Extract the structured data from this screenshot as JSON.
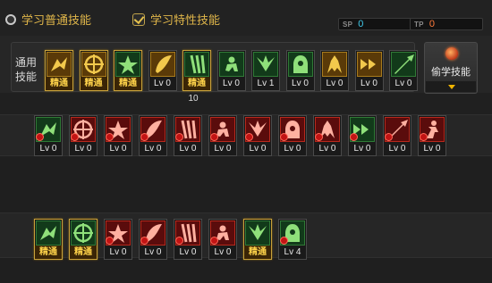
{
  "tabs": {
    "normal": {
      "label": "学习普通技能",
      "selected": false
    },
    "special": {
      "label": "学习特性技能",
      "selected": true
    }
  },
  "counters": [
    {
      "tag": "SP",
      "value": "0",
      "color": "#40c8e8"
    },
    {
      "tag": "TP",
      "value": "0",
      "color": "#ff7a3a"
    }
  ],
  "general": {
    "label": "通用技能",
    "cost_value": "10",
    "skills": [
      {
        "icon": "seated-figure-icon",
        "status": "精通",
        "mastered": true,
        "hue": "gold"
      },
      {
        "icon": "leaping-figure-icon",
        "status": "精通",
        "mastered": true,
        "hue": "gold"
      },
      {
        "icon": "runner-icon",
        "status": "精通",
        "mastered": true,
        "hue": "green"
      },
      {
        "icon": "wings-icon",
        "status": "Lv 0",
        "mastered": false,
        "hue": "gold"
      },
      {
        "icon": "crosshair-icon",
        "status": "精通",
        "mastered": true,
        "hue": "green"
      },
      {
        "icon": "gear-arrows-icon",
        "status": "Lv 0",
        "mastered": false,
        "hue": "green"
      },
      {
        "icon": "hooded-figure-icon",
        "status": "Lv 1",
        "mastered": false,
        "hue": "green"
      },
      {
        "icon": "figure-burst-icon",
        "status": "Lv 0",
        "mastered": false,
        "hue": "green"
      },
      {
        "icon": "coin-icon",
        "status": "Lv 0",
        "mastered": false,
        "hue": "gold"
      },
      {
        "icon": "golden-figure-icon",
        "status": "Lv 0",
        "mastered": false,
        "hue": "gold"
      },
      {
        "icon": "leaf-figure-icon",
        "status": "Lv 0",
        "mastered": false,
        "hue": "green"
      }
    ]
  },
  "steal": {
    "label": "偷学技能"
  },
  "class_row_1": [
    {
      "icon": "runner-green-icon",
      "status": "Lv 0",
      "mastered": false
    },
    {
      "icon": "slash-arc-icon",
      "status": "Lv 0",
      "mastered": false
    },
    {
      "icon": "slash-arc-icon",
      "status": "Lv 0",
      "mastered": false
    },
    {
      "icon": "double-chevron-icon",
      "status": "Lv 0",
      "mastered": false
    },
    {
      "icon": "claw-marks-icon",
      "status": "Lv 0",
      "mastered": false
    },
    {
      "icon": "shield-cross-icon",
      "status": "Lv 0",
      "mastered": false
    },
    {
      "icon": "spear-thrust-icon",
      "status": "Lv 0",
      "mastered": false
    },
    {
      "icon": "crescent-slash-icon",
      "status": "Lv 0",
      "mastered": false
    },
    {
      "icon": "blade-spin-icon",
      "status": "Lv 0",
      "mastered": false
    },
    {
      "icon": "burst-star-icon",
      "status": "Lv 0",
      "mastered": false
    },
    {
      "icon": "burst-star-icon",
      "status": "Lv 0",
      "mastered": false
    },
    {
      "icon": "runner-green-icon",
      "status": "Lv 0",
      "mastered": false
    }
  ],
  "class_row_2": [
    {
      "icon": "leaf-sword-icon",
      "status": "精通",
      "mastered": true
    },
    {
      "icon": "serpent-icon",
      "status": "精通",
      "mastered": true
    },
    {
      "icon": "dash-streak-icon",
      "status": "Lv 0",
      "mastered": false
    },
    {
      "icon": "dark-explosion-icon",
      "status": "Lv 0",
      "mastered": false
    },
    {
      "icon": "spark-burst-icon",
      "status": "Lv 0",
      "mastered": false
    },
    {
      "icon": "shadow-spin-icon",
      "status": "Lv 0",
      "mastered": false
    },
    {
      "icon": "sword-wave-icon",
      "status": "精通",
      "mastered": true
    },
    {
      "icon": "warrior-lunge-icon",
      "status": "Lv 4",
      "mastered": false
    }
  ]
}
